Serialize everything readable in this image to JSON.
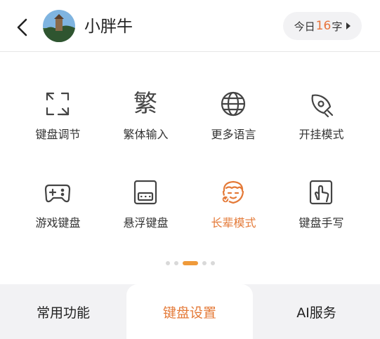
{
  "header": {
    "user_name": "小胖牛",
    "word_count": {
      "prefix": "今日",
      "value": "16",
      "suffix": "字"
    }
  },
  "features": [
    {
      "label": "键盘调节",
      "icon": "resize-icon",
      "active": false
    },
    {
      "label": "繁体输入",
      "icon": "traditional-char-icon",
      "active": false,
      "glyph": "繁"
    },
    {
      "label": "更多语言",
      "icon": "globe-icon",
      "active": false
    },
    {
      "label": "开挂模式",
      "icon": "rocket-icon",
      "active": false
    },
    {
      "label": "游戏键盘",
      "icon": "gamepad-icon",
      "active": false
    },
    {
      "label": "悬浮键盘",
      "icon": "floating-keyboard-icon",
      "active": false
    },
    {
      "label": "长辈模式",
      "icon": "elder-face-icon",
      "active": true
    },
    {
      "label": "键盘手写",
      "icon": "handwriting-icon",
      "active": false
    }
  ],
  "pager": {
    "pages": 5,
    "current": 3
  },
  "tabs": [
    {
      "label": "常用功能",
      "selected": false
    },
    {
      "label": "键盘设置",
      "selected": true
    },
    {
      "label": "AI服务",
      "selected": false
    }
  ],
  "colors": {
    "accent": "#e47a38",
    "icon": "#444444",
    "tab_bg": "#f2f2f4"
  }
}
